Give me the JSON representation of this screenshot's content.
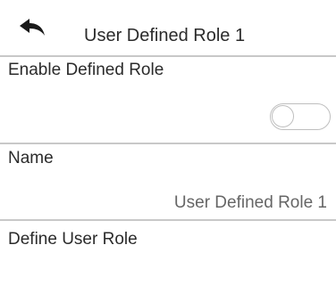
{
  "header": {
    "back_icon": "back-arrow-icon",
    "title": "User Defined Role 1"
  },
  "enable_section": {
    "label": "Enable Defined Role",
    "toggle_on": false
  },
  "name_section": {
    "label": "Name",
    "value": "User Defined Role 1"
  },
  "define_section": {
    "label": "Define User Role"
  },
  "colors": {
    "background": "#ffffff",
    "text": "#2b2b2b",
    "value_text": "#666666",
    "divider": "#c8c8c8"
  }
}
